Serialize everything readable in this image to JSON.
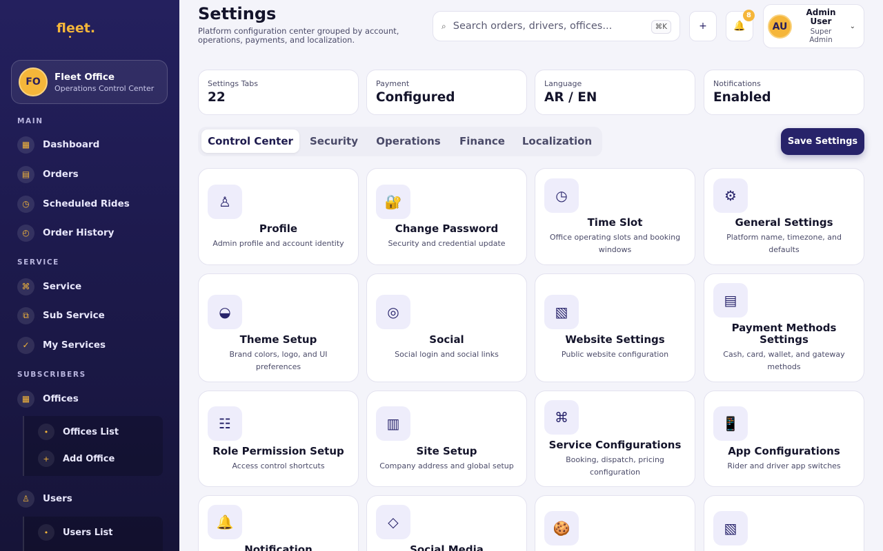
{
  "sidebar": {
    "brand": "fleet.",
    "office": {
      "initials": "FO",
      "name": "Fleet Office",
      "subtitle": "Operations Control Center"
    },
    "sections": {
      "main": "MAIN",
      "service": "SERVICE",
      "subscribers": "SUBSCRIBERS"
    },
    "items": {
      "dashboard": "Dashboard",
      "orders": "Orders",
      "scheduled": "Scheduled Rides",
      "history": "Order History",
      "service": "Service",
      "sub_service": "Sub Service",
      "my_services": "My Services",
      "offices": "Offices",
      "offices_list": "Offices List",
      "add_office": "Add Office",
      "users": "Users",
      "users_list": "Users List"
    }
  },
  "header": {
    "title": "Settings",
    "description": "Platform configuration center grouped by account, operations, payments, and localization.",
    "search_placeholder": "Search orders, drivers, offices...",
    "search_shortcut": "⌘K",
    "add_label": "+",
    "notification_count": "8",
    "user": {
      "initials": "AU",
      "name": "Admin User",
      "role": "Super Admin"
    }
  },
  "stats": [
    {
      "label": "Settings Tabs",
      "value": "22"
    },
    {
      "label": "Payment",
      "value": "Configured"
    },
    {
      "label": "Language",
      "value": "AR / EN"
    },
    {
      "label": "Notifications",
      "value": "Enabled"
    }
  ],
  "tabs": [
    "Control Center",
    "Security",
    "Operations",
    "Finance",
    "Localization"
  ],
  "active_tab": "Control Center",
  "save_label": "Save Settings",
  "cards": [
    {
      "icon": "person-icon",
      "title": "Profile",
      "desc": "Admin profile and account identity"
    },
    {
      "icon": "lock-icon",
      "title": "Change Password",
      "desc": "Security and credential update"
    },
    {
      "icon": "clock-icon",
      "title": "Time Slot",
      "desc": "Office operating slots and booking windows"
    },
    {
      "icon": "gear-icon",
      "title": "General Settings",
      "desc": "Platform name, timezone, and defaults"
    },
    {
      "icon": "theme-icon",
      "title": "Theme Setup",
      "desc": "Brand colors, logo, and UI preferences"
    },
    {
      "icon": "target-icon",
      "title": "Social",
      "desc": "Social login and social links"
    },
    {
      "icon": "website-icon",
      "title": "Website Settings",
      "desc": "Public website configuration"
    },
    {
      "icon": "card-icon",
      "title": "Payment Methods Settings",
      "desc": "Cash, card, wallet, and gateway methods"
    },
    {
      "icon": "list-icon",
      "title": "Role Permission Setup",
      "desc": "Access control shortcuts"
    },
    {
      "icon": "building-icon",
      "title": "Site Setup",
      "desc": "Company address and global setup"
    },
    {
      "icon": "command-icon",
      "title": "Service Configurations",
      "desc": "Booking, dispatch, pricing configuration"
    },
    {
      "icon": "phone-icon",
      "title": "App Configurations",
      "desc": "Rider and driver app switches"
    },
    {
      "icon": "bell-icon",
      "title": "Notification",
      "desc": ""
    },
    {
      "icon": "diamond-icon",
      "title": "Social Media",
      "desc": ""
    },
    {
      "icon": "cookie-icon",
      "title": "",
      "desc": ""
    },
    {
      "icon": "pattern-icon",
      "title": "",
      "desc": ""
    }
  ]
}
